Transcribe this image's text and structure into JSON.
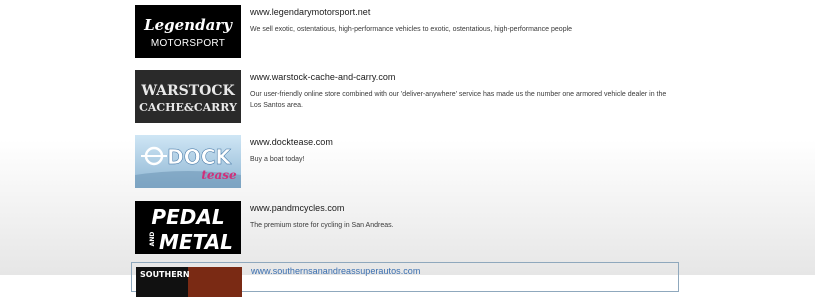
{
  "listings": [
    {
      "logo_text": [
        "Legendary",
        "MOTORSPORT"
      ],
      "url": "www.legendarymotorsport.net",
      "description": "We sell exotic, ostentatious, high-performance vehicles to exotic, ostentatious, high-performance people"
    },
    {
      "logo_text": [
        "WARSTOCK",
        "CACHE&CARRY"
      ],
      "url": "www.warstock-cache-and-carry.com",
      "description": "Our user-friendly online store combined with our 'deliver-anywhere' service has made us the number one armored vehicle dealer in the Los Santos area."
    },
    {
      "logo_text": [
        "DOCK",
        "tease"
      ],
      "url": "www.docktease.com",
      "description": "Buy a boat today!"
    },
    {
      "logo_text": [
        "PEDAL",
        "AND",
        "METAL"
      ],
      "url": "www.pandmcycles.com",
      "description": "The premium store for cycling in San Andreas."
    },
    {
      "logo_text": [
        "SOUTHERN"
      ],
      "url": "www.southernsanandreassuperautos.com",
      "description": ""
    }
  ]
}
